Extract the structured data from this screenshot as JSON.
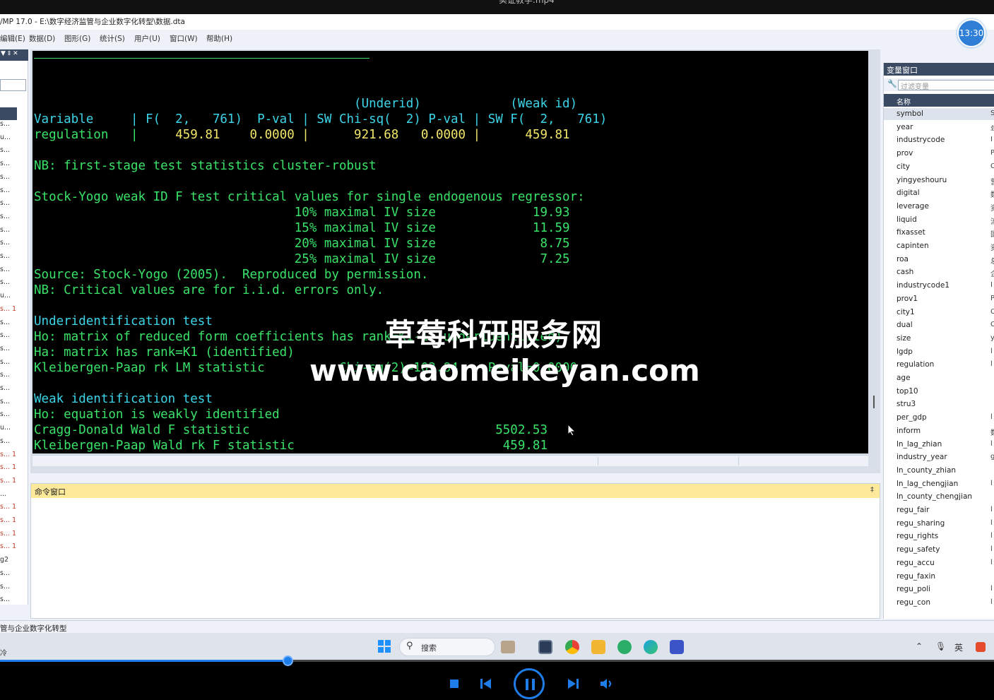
{
  "video": {
    "top_title": "实证教学.mp4"
  },
  "window": {
    "title": "/MP 17.0 - E:\\数字经济监管与企业数字化转型\\数据.dta"
  },
  "menu": [
    "编辑(E)",
    "数据(D)",
    "图形(G)",
    "统计(S)",
    "用户(U)",
    "窗口(W)",
    "帮助(H)"
  ],
  "clock": "13:30",
  "left_panel": {
    "items": [
      "s...",
      "u...",
      "s...",
      "s...",
      "s...",
      "s...",
      "s...",
      "s...",
      "s...",
      "s...",
      "s...",
      "s...",
      "s...",
      "u...",
      "s... 1",
      "s...",
      "s...",
      "s...",
      "s...",
      "s...",
      "s...",
      "s...",
      "s...",
      "u...",
      "s...",
      "s... 1",
      "s... 1",
      "s... 1",
      "...",
      "s... 1",
      "s... 1",
      "s... 1",
      "s... 1",
      "g2",
      "s...",
      "s...",
      "s..."
    ],
    "red_indices": [
      14,
      25,
      26,
      27,
      29,
      30,
      31,
      32
    ]
  },
  "results": {
    "lines": [
      {
        "t": "                                           (Underid)            (Weak id)",
        "c": "c"
      },
      {
        "t": "Variable     | F(  2,   761)  P-val | SW Chi-sq(  2) P-val | SW F(  2,   761)",
        "c": "c"
      },
      {
        "t": "regulation   |     459.81    0.0000 |      921.68   0.0000 |      459.81",
        "c": "y",
        "prefix": "regulation   |",
        "prefix_c": "g"
      },
      {
        "t": "",
        "c": "g"
      },
      {
        "t": "NB: first-stage test statistics cluster-robust",
        "c": "g"
      },
      {
        "t": "",
        "c": "g"
      },
      {
        "t": "Stock-Yogo weak ID F test critical values for single endogenous regressor:",
        "c": "g"
      },
      {
        "t": "                                   10% maximal IV size             19.93",
        "c": "g"
      },
      {
        "t": "                                   15% maximal IV size             11.59",
        "c": "g"
      },
      {
        "t": "                                   20% maximal IV size              8.75",
        "c": "g"
      },
      {
        "t": "                                   25% maximal IV size              7.25",
        "c": "g"
      },
      {
        "t": "Source: Stock-Yogo (2005).  Reproduced by permission.",
        "c": "g"
      },
      {
        "t": "NB: Critical values are for i.i.d. errors only.",
        "c": "g"
      },
      {
        "t": "",
        "c": "g"
      },
      {
        "t": "Underidentification test",
        "c": "c"
      },
      {
        "t": "Ho: matrix of reduced form coefficients has rank=K1-1 (underidentified)",
        "c": "g"
      },
      {
        "t": "Ha: matrix has rank=K1 (identified)",
        "c": "g"
      },
      {
        "t": "Kleibergen-Paap rk LM statistic          Chi-sq(2)=102.84    P-val=0.0000",
        "c": "g"
      },
      {
        "t": "",
        "c": "g"
      },
      {
        "t": "Weak identification test",
        "c": "c"
      },
      {
        "t": "Ho: equation is weakly identified",
        "c": "g"
      },
      {
        "t": "Cragg-Donald Wald F statistic                                 5502.53",
        "c": "g"
      },
      {
        "t": "Kleibergen-Paap Wald rk F statistic                            459.81",
        "c": "g"
      }
    ]
  },
  "watermark": {
    "line1": "草莓科研服务网",
    "line2": "www.caomeikeyan.com"
  },
  "command_window": {
    "title": "命令窗口"
  },
  "variables": {
    "title": "变量窗口",
    "filter_placeholder": "过滤变量",
    "col_name": "名称",
    "items": [
      {
        "n": "symbol",
        "t": "S"
      },
      {
        "n": "year",
        "t": "年"
      },
      {
        "n": "industrycode",
        "t": "I"
      },
      {
        "n": "prov",
        "t": "P"
      },
      {
        "n": "city",
        "t": "C"
      },
      {
        "n": "yingyeshouru",
        "t": "营"
      },
      {
        "n": "digital",
        "t": "数"
      },
      {
        "n": "leverage",
        "t": "资"
      },
      {
        "n": "liquid",
        "t": "流"
      },
      {
        "n": "fixasset",
        "t": "固"
      },
      {
        "n": "capinten",
        "t": "资"
      },
      {
        "n": "roa",
        "t": "总"
      },
      {
        "n": "cash",
        "t": "企"
      },
      {
        "n": "industrycode1",
        "t": "I"
      },
      {
        "n": "prov1",
        "t": "P"
      },
      {
        "n": "city1",
        "t": "C"
      },
      {
        "n": "dual",
        "t": "C"
      },
      {
        "n": "size",
        "t": "y"
      },
      {
        "n": "lgdp",
        "t": "l"
      },
      {
        "n": "regulation",
        "t": "l"
      },
      {
        "n": "age",
        "t": ""
      },
      {
        "n": "top10",
        "t": ""
      },
      {
        "n": "stru3",
        "t": ""
      },
      {
        "n": "per_gdp",
        "t": "l"
      },
      {
        "n": "inform",
        "t": "数"
      },
      {
        "n": "ln_lag_zhian",
        "t": "l"
      },
      {
        "n": "industry_year",
        "t": "g"
      },
      {
        "n": "ln_county_zhian",
        "t": ""
      },
      {
        "n": "ln_lag_chengjian",
        "t": "l"
      },
      {
        "n": "ln_county_chengjian",
        "t": ""
      },
      {
        "n": "regu_fair",
        "t": "l"
      },
      {
        "n": "regu_sharing",
        "t": "l"
      },
      {
        "n": "regu_rights",
        "t": "l"
      },
      {
        "n": "regu_safety",
        "t": "l"
      },
      {
        "n": "regu_accu",
        "t": "l"
      },
      {
        "n": "regu_faxin",
        "t": ""
      },
      {
        "n": "regu_poli",
        "t": "l"
      },
      {
        "n": "regu_con",
        "t": "l"
      }
    ]
  },
  "status_bar": {
    "text": "管与企业数字化转型"
  },
  "taskbar": {
    "left_text": "冷",
    "search_label": "搜索",
    "ime": "英"
  },
  "player": {
    "progress": 0.289
  }
}
